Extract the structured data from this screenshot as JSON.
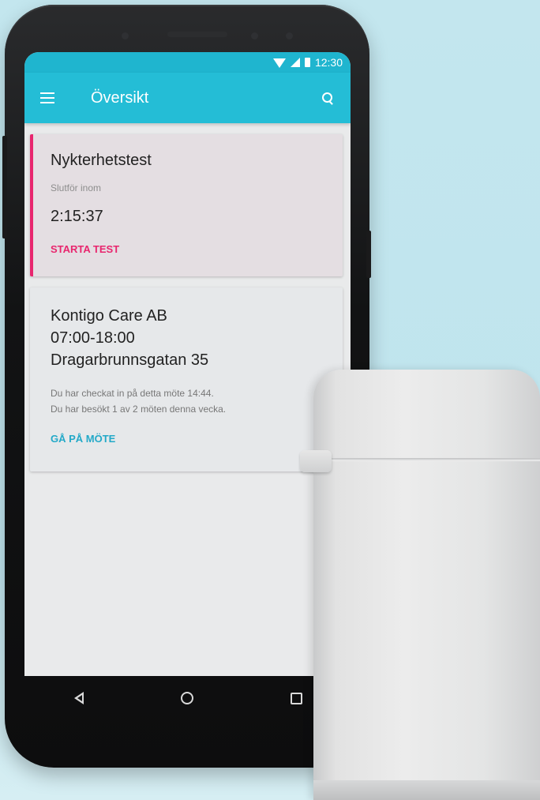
{
  "statusbar": {
    "time": "12:30"
  },
  "appbar": {
    "title": "Översikt"
  },
  "cards": {
    "test": {
      "title": "Nykterhetstest",
      "subtitle": "Slutför inom",
      "timer": "2:15:37",
      "action": "STARTA TEST"
    },
    "meeting": {
      "name": "Kontigo Care AB",
      "hours": "07:00-18:00",
      "address": "Dragarbrunnsgatan 35",
      "checkin_text": "Du har checkat in på detta möte 14:44.",
      "visits_text": "Du har besökt 1 av 2 möten denna vecka.",
      "action": "GÅ PÅ MÖTE"
    }
  },
  "colors": {
    "accent": "#24bdd6",
    "pink": "#e8266e",
    "cyan_action": "#23a9c8"
  },
  "icons": {
    "menu": "menu-icon",
    "search": "search-icon",
    "back": "back-icon",
    "home": "home-icon",
    "recents": "recents-icon"
  }
}
